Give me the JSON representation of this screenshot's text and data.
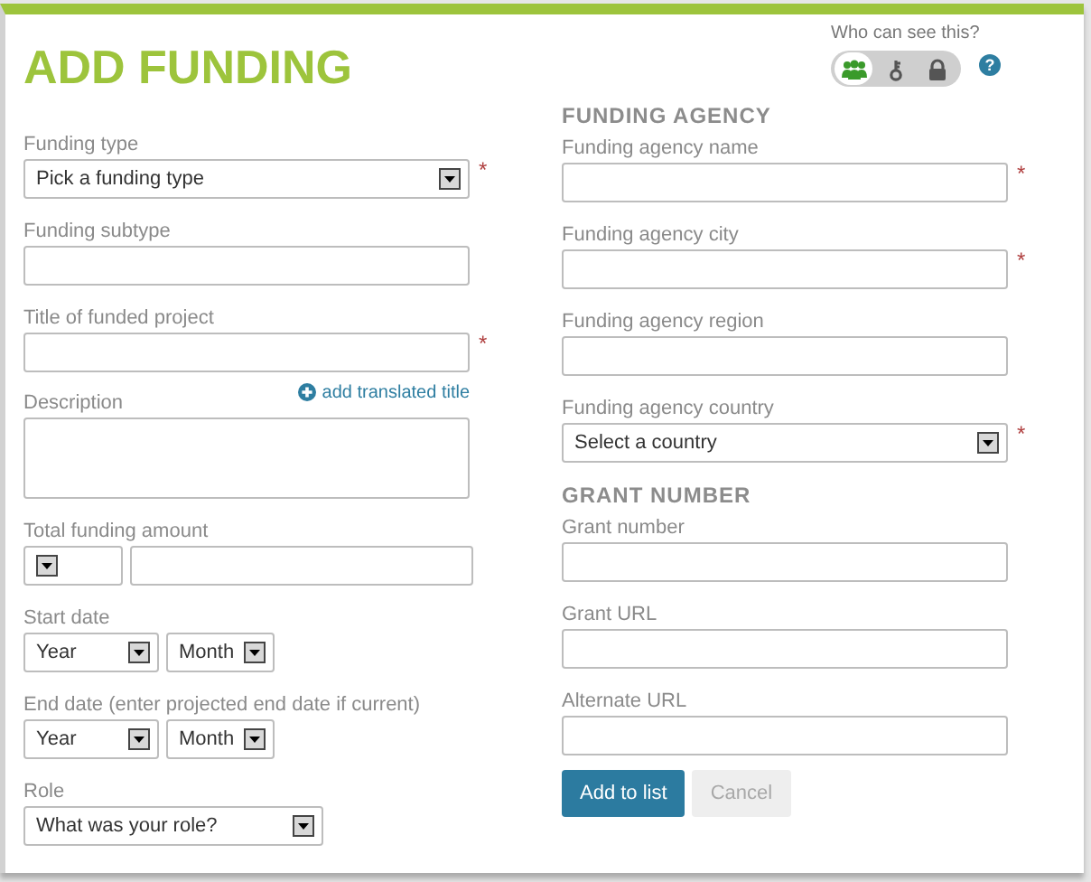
{
  "title": "ADD FUNDING",
  "visibility": {
    "label": "Who can see this?",
    "help": "?",
    "options": [
      {
        "kind": "everyone",
        "selected": true
      },
      {
        "kind": "trusted",
        "selected": false
      },
      {
        "kind": "private",
        "selected": false
      }
    ]
  },
  "left_fields": [
    {
      "label": "Funding type",
      "kind": "select",
      "value": "Pick a funding type",
      "required_mark": "*"
    },
    {
      "label": "Funding subtype",
      "kind": "text"
    },
    {
      "label": "Title of funded project",
      "kind": "text",
      "required_mark": "*",
      "link": "add translated title"
    },
    {
      "label": "Description",
      "kind": "textarea"
    },
    {
      "label": "Total funding amount",
      "kind": "amount"
    },
    {
      "label": "Start date",
      "kind": "date",
      "selects": [
        "Year",
        "Month"
      ]
    },
    {
      "label": "End date (enter projected end date if current)",
      "kind": "date",
      "selects": [
        "Year",
        "Month"
      ]
    },
    {
      "label": "Role",
      "kind": "short-select",
      "value": "What was your role?"
    }
  ],
  "right_sections": [
    {
      "heading": "FUNDING AGENCY",
      "fields": [
        {
          "label": "Funding agency name",
          "kind": "text",
          "required_mark": "*"
        },
        {
          "label": "Funding agency city",
          "kind": "text",
          "required_mark": "*"
        },
        {
          "label": "Funding agency region",
          "kind": "text"
        },
        {
          "label": "Funding agency country",
          "kind": "select",
          "value": "Select a country",
          "required_mark": "*"
        }
      ]
    },
    {
      "heading": "GRANT NUMBER",
      "fields": [
        {
          "label": "Grant number",
          "kind": "text"
        },
        {
          "label": "Grant URL",
          "kind": "text"
        },
        {
          "label": "Alternate URL",
          "kind": "text"
        }
      ]
    }
  ],
  "buttons": [
    {
      "label": "Add to list",
      "kind": "primary"
    },
    {
      "label": "Cancel",
      "kind": "secondary"
    }
  ]
}
